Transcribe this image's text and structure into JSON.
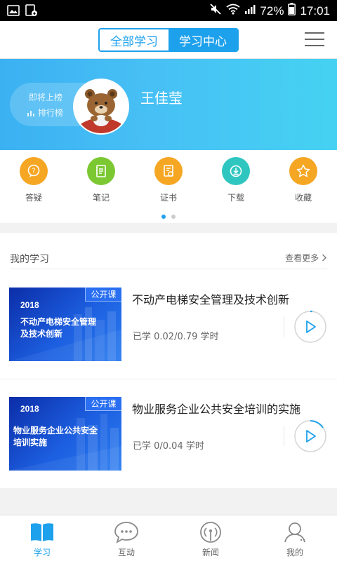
{
  "status_bar": {
    "battery": "72%",
    "time": "17:01"
  },
  "header": {
    "tabs": [
      {
        "label": "全部学习",
        "active": false
      },
      {
        "label": "学习中心",
        "active": true
      }
    ]
  },
  "profile": {
    "rank_status": "即将上榜",
    "rank_link": "排行榜",
    "name": "王佳莹"
  },
  "quick_actions": [
    {
      "label": "答疑",
      "icon": "qa-icon",
      "color": "#f5a623"
    },
    {
      "label": "笔记",
      "icon": "notes-icon",
      "color": "#7cc832"
    },
    {
      "label": "证书",
      "icon": "certificate-icon",
      "color": "#f5a623"
    },
    {
      "label": "下载",
      "icon": "download-icon",
      "color": "#2fc6c0"
    },
    {
      "label": "收藏",
      "icon": "favorite-icon",
      "color": "#f5a623"
    }
  ],
  "pager": {
    "pages": 2,
    "current": 1
  },
  "my_learning": {
    "title": "我的学习",
    "more": "查看更多",
    "courses": [
      {
        "tag": "公开课",
        "thumb_year": "2018",
        "thumb_lines": [
          "不动产电梯安全管理",
          "及技术创新"
        ],
        "name": "不动产电梯安全管理及技术创新",
        "progress": "已学 0.02/0.79 学时"
      },
      {
        "tag": "公开课",
        "thumb_year": "2018",
        "thumb_lines": [
          "物业服务企业公共安全",
          "培训实施"
        ],
        "name": "物业服务企业公共安全培训的实施",
        "progress": "已学 0/0.04 学时"
      }
    ]
  },
  "tab_bar": [
    {
      "label": "学习",
      "icon": "book-icon",
      "active": true
    },
    {
      "label": "互动",
      "icon": "chat-bubble-icon",
      "active": false
    },
    {
      "label": "新闻",
      "icon": "broadcast-icon",
      "active": false
    },
    {
      "label": "我的",
      "icon": "person-icon",
      "active": false
    }
  ],
  "colors": {
    "accent": "#1ea1ec",
    "banner_start": "#3bb1f2",
    "banner_end": "#45d2f2"
  }
}
